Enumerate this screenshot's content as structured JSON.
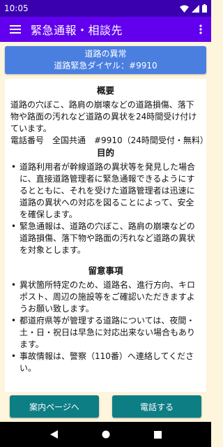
{
  "status_bar": {
    "time": "10:05"
  },
  "app_bar": {
    "title": "緊急通報・相談先"
  },
  "banner": {
    "line1": "道路の異常",
    "line2": "道路緊急ダイヤル：#9910"
  },
  "overview": {
    "title": "概要",
    "text": "道路の穴ぼこ、路肩の崩壊などの道路損傷、落下物や路面の汚れなど道路の異状を24時間受け付けています。",
    "phone": "電話番号　全国共通　#9910（24時間受付・無料）"
  },
  "purpose": {
    "title": "目的",
    "items": [
      "道路利用者が幹線道路の異状等を発見した場合に、直接道路管理者に緊急通報できるようにするとともに、それを受けた道路管理者は迅速に道路の異状への対応を図ることによって、安全を確保します。",
      "緊急通報は、道路の穴ぼこ、路肩の崩壊などの道路損傷、落下物や路面の汚れなど道路の異状を対象とします。"
    ]
  },
  "notes": {
    "title": "留意事項",
    "items": [
      "異状箇所特定のため、道路名、進行方向、キロポスト、周辺の施設等をご確認いただきますようお願い致します。",
      "都道府県等が管理する道路については、夜間・土・日・祝日は早急に対応出来ない場合もあります。",
      "事故情報は、警察（110番）へ連絡してください。"
    ]
  },
  "buttons": {
    "guide": "案内ページへ",
    "call": "電話する"
  }
}
